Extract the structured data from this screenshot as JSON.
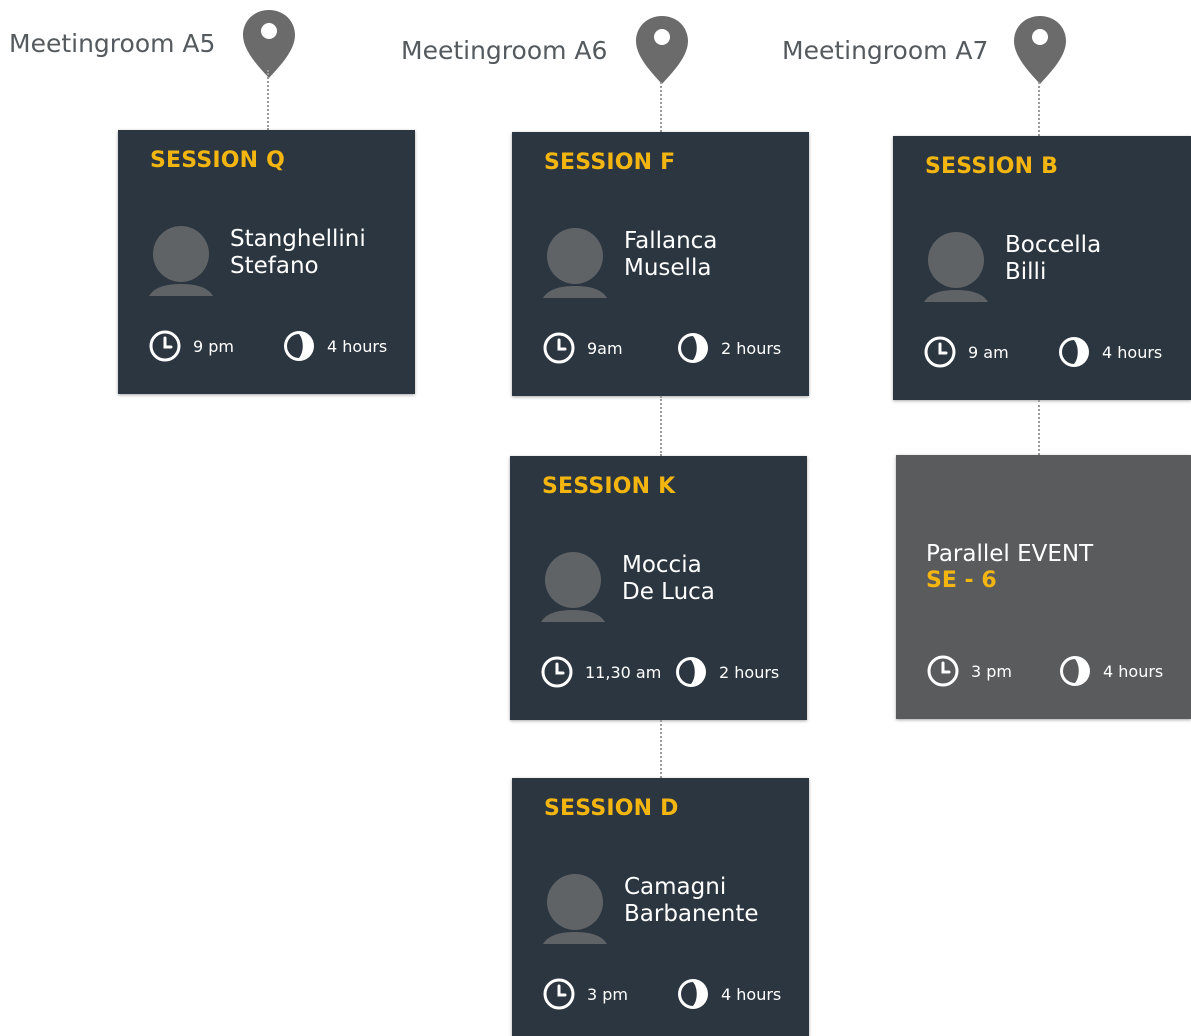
{
  "rooms": {
    "a5": {
      "name": "Meetingroom A5"
    },
    "a6": {
      "name": "Meetingroom A6"
    },
    "a7": {
      "name": "Meetingroom A7"
    }
  },
  "sessions": {
    "q": {
      "title": "SESSION Q",
      "speaker_line1": "Stanghellini",
      "speaker_line2": "Stefano",
      "time": "9 pm",
      "duration": "4 hours"
    },
    "f": {
      "title": "SESSION F",
      "speaker_line1": "Fallanca",
      "speaker_line2": "Musella",
      "time": "9am",
      "duration": "2 hours"
    },
    "k": {
      "title": "SESSION K",
      "speaker_line1": "Moccia",
      "speaker_line2": "De Luca",
      "time": "11,30 am",
      "duration": "2 hours"
    },
    "d": {
      "title": "SESSION D",
      "speaker_line1": "Camagni",
      "speaker_line2": "Barbanente",
      "time": "3 pm",
      "duration": "4 hours"
    },
    "b": {
      "title": "SESSION B",
      "speaker_line1": "Boccella",
      "speaker_line2": "Billi",
      "time": "9 am",
      "duration": "4 hours"
    }
  },
  "parallel_event": {
    "label": "Parallel EVENT",
    "code": "SE - 6",
    "time": "3 pm",
    "duration": "4 hours"
  },
  "colors": {
    "card_background": "#2c3640",
    "parallel_background": "#5a5b5c",
    "accent": "#f3b50f",
    "pin": "#6b6b6b",
    "label": "#555a5e"
  },
  "icons": {
    "location": "map-pin-icon",
    "time": "clock-icon",
    "duration": "half-circle-duration-icon",
    "speaker": "avatar-silhouette-icon"
  }
}
